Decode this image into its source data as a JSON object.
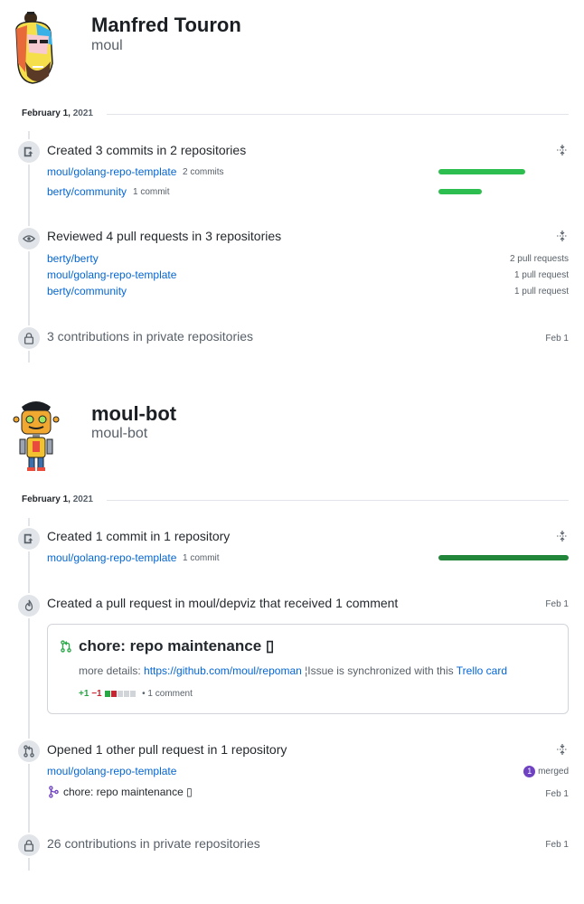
{
  "users": [
    {
      "name": "Manfred Touron",
      "login": "moul",
      "date_month_day": "February 1,",
      "date_year": "2021",
      "commits": {
        "title": "Created 3 commits in 2 repositories",
        "repos": [
          {
            "name": "moul/golang-repo-template",
            "count": "2 commits",
            "fraction": 0.67
          },
          {
            "name": "berty/community",
            "count": "1 commit",
            "fraction": 0.33
          }
        ]
      },
      "reviews": {
        "title": "Reviewed 4 pull requests in 3 repositories",
        "repos": [
          {
            "name": "berty/berty",
            "count": "2 pull requests"
          },
          {
            "name": "moul/golang-repo-template",
            "count": "1 pull request"
          },
          {
            "name": "berty/community",
            "count": "1 pull request"
          }
        ]
      },
      "private": {
        "title": "3 contributions in private repositories",
        "date": "Feb 1"
      }
    },
    {
      "name": "moul-bot",
      "login": "moul-bot",
      "date_month_day": "February 1,",
      "date_year": "2021",
      "commits": {
        "title": "Created 1 commit in 1 repository",
        "repos": [
          {
            "name": "moul/golang-repo-template",
            "count": "1 commit",
            "fraction": 1.0
          }
        ]
      },
      "pr_created": {
        "title": "Created a pull request in moul/depviz that received 1 comment",
        "date": "Feb 1",
        "pr_title": "chore: repo maintenance",
        "pr_title_emoji": "▯",
        "body_prefix": "more details: ",
        "body_link": "https://github.com/moul/repoman",
        "body_mid": " ¦Issue is synchronized with this ",
        "body_link2": "Trello card",
        "additions": "+1",
        "deletions": "−1",
        "comments": "• 1 comment"
      },
      "opened": {
        "title": "Opened 1 other pull request in 1 repository",
        "repo": "moul/golang-repo-template",
        "merged_count": "1",
        "merged_label": "merged",
        "pr_title": "chore: repo maintenance",
        "pr_title_emoji": "▯",
        "date": "Feb 1"
      },
      "private": {
        "title": "26 contributions in private repositories",
        "date": "Feb 1"
      }
    }
  ],
  "icons": {
    "commit": "repo-push-icon",
    "eye": "eye-icon",
    "lock": "lock-icon",
    "flame": "flame-icon",
    "pr": "git-pull-request-icon",
    "merge": "git-merge-icon",
    "fold": "fold-icon"
  },
  "colors": {
    "link": "#0366d6",
    "bar": "#2cbe4e",
    "bar_dark": "#22863a",
    "merged": "#6f42c1",
    "pr_open": "#28a745"
  }
}
